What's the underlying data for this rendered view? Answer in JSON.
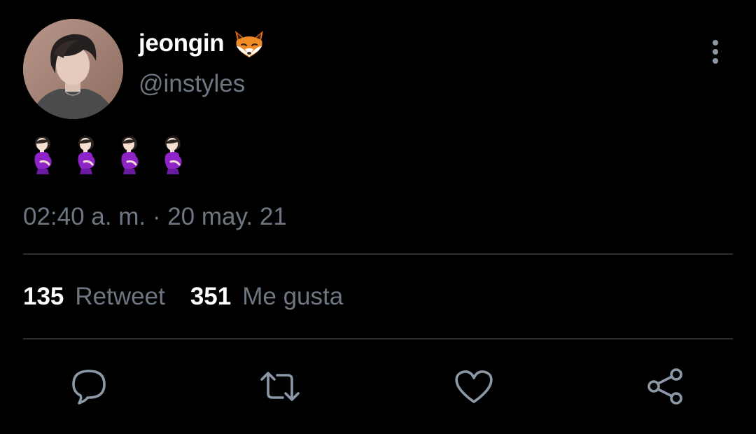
{
  "tweet": {
    "author": {
      "display_name": "jeongin",
      "handle": "@instyles",
      "name_emoji": "fox-face-emoji",
      "avatar": "profile-photo"
    },
    "body_emojis": [
      "pregnant-woman-emoji",
      "pregnant-woman-emoji",
      "pregnant-woman-emoji",
      "pregnant-woman-emoji"
    ],
    "timestamp": "02:40 a. m. · 20 may. 21",
    "stats": {
      "retweets_count": "135",
      "retweets_label": "Retweet",
      "likes_count": "351",
      "likes_label": "Me gusta"
    }
  },
  "actions": [
    {
      "icon": "reply-icon"
    },
    {
      "icon": "retweet-icon"
    },
    {
      "icon": "like-icon"
    },
    {
      "icon": "share-icon"
    }
  ],
  "menu": {
    "icon": "more-vertical-icon"
  },
  "colors": {
    "background": "#000000",
    "primary_text": "#ffffff",
    "secondary_text": "#6e7781",
    "divider": "#2a2e33",
    "icon": "#8b98a5"
  }
}
